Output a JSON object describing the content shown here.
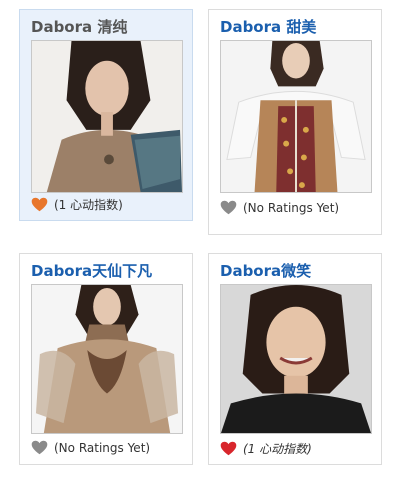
{
  "items": [
    {
      "title": "Dabora 清纯",
      "rating_text": "(1 心动指数)",
      "heart_color": "#e8762c",
      "selected": true
    },
    {
      "title": "Dabora 甜美",
      "rating_text": "(No Ratings Yet)",
      "heart_color": "#8a8a8a",
      "selected": false
    },
    {
      "title": "Dabora天仙下凡",
      "rating_text": "(No Ratings Yet)",
      "heart_color": "#8a8a8a",
      "selected": false
    },
    {
      "title": "Dabora微笑",
      "rating_text": "(1 心动指数)",
      "heart_color": "#d8262c",
      "selected": false
    }
  ],
  "icons": {
    "rating_icon": "heart-icon"
  }
}
